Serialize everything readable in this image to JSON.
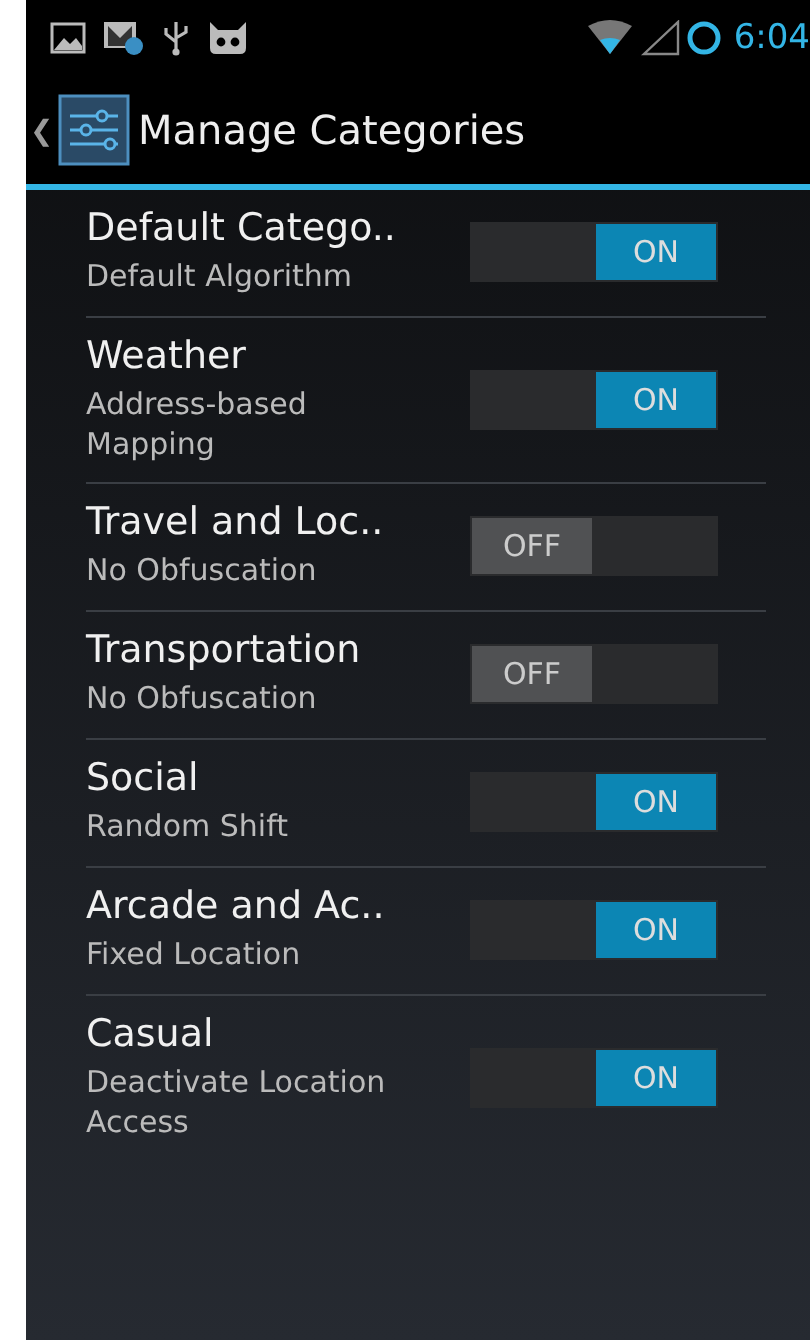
{
  "status_bar": {
    "time": "6:04"
  },
  "action_bar": {
    "back": "❮",
    "title": "Manage Categories"
  },
  "categories": [
    {
      "title": "Default Catego..",
      "subtitle": "Default Algorithm",
      "on": true,
      "toggle_text": "ON"
    },
    {
      "title": "Weather",
      "subtitle": "Address-based Mapping",
      "on": true,
      "toggle_text": "ON"
    },
    {
      "title": "Travel and Loc..",
      "subtitle": "No Obfuscation",
      "on": false,
      "toggle_text": "OFF"
    },
    {
      "title": "Transportation",
      "subtitle": "No Obfuscation",
      "on": false,
      "toggle_text": "OFF"
    },
    {
      "title": "Social",
      "subtitle": "Random Shift",
      "on": true,
      "toggle_text": "ON"
    },
    {
      "title": "Arcade and Ac..",
      "subtitle": "Fixed Location",
      "on": true,
      "toggle_text": "ON"
    },
    {
      "title": "Casual",
      "subtitle": "Deactivate Location Access",
      "on": true,
      "toggle_text": "ON"
    }
  ]
}
